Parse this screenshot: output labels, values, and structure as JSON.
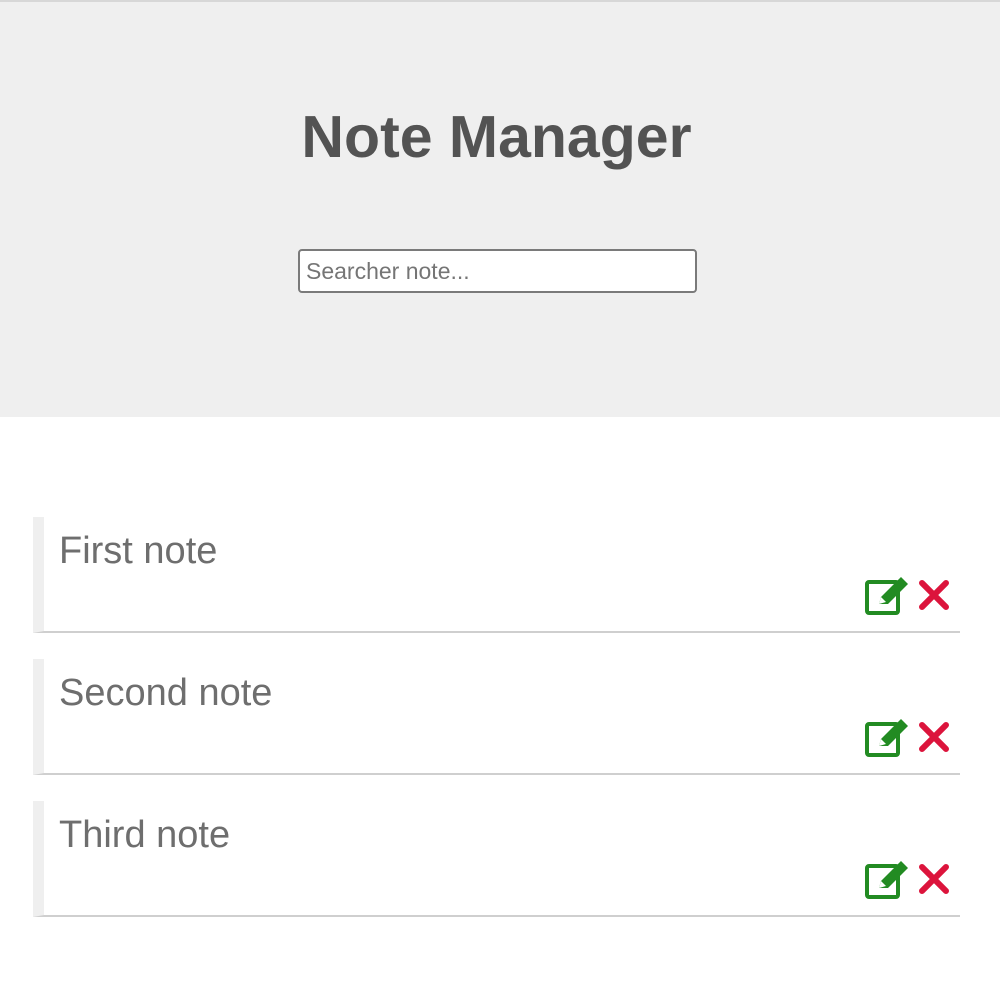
{
  "header": {
    "title": "Note Manager",
    "search": {
      "placeholder": "Searcher note...",
      "value": ""
    }
  },
  "notes": [
    {
      "title": "First note",
      "edit_icon": "edit-icon",
      "delete_icon": "close-icon"
    },
    {
      "title": "Second note",
      "edit_icon": "edit-icon",
      "delete_icon": "close-icon"
    },
    {
      "title": "Third note",
      "edit_icon": "edit-icon",
      "delete_icon": "close-icon"
    }
  ],
  "colors": {
    "header_background": "#efefef",
    "title_text": "#535353",
    "note_text": "#6e6e6e",
    "edit_icon": "#228b22",
    "delete_icon": "#dc143c"
  }
}
